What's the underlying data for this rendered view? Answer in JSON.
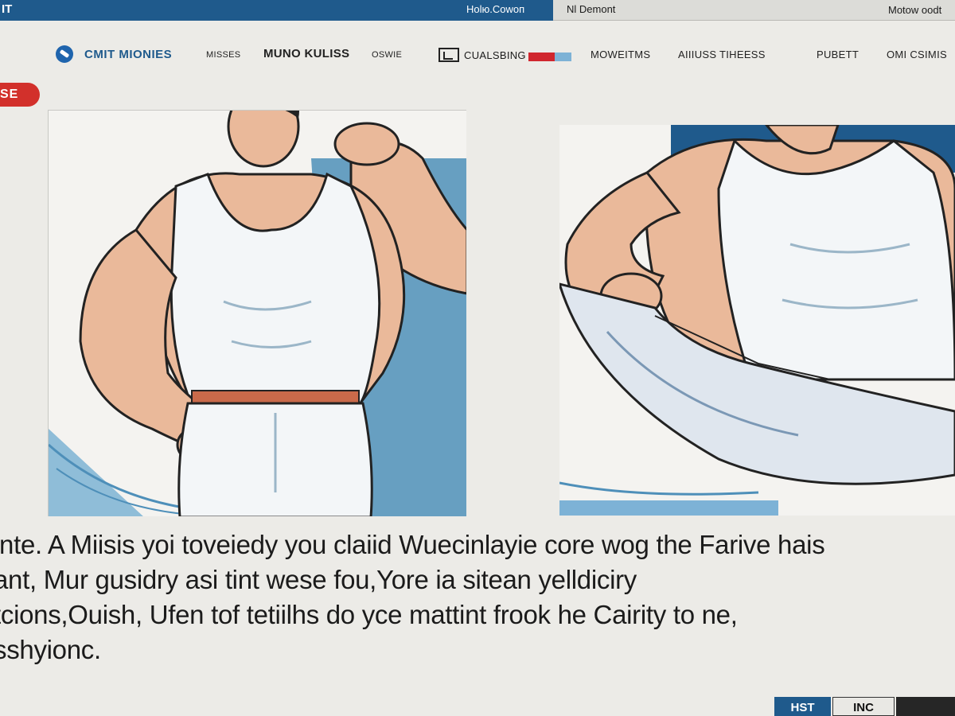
{
  "topbar": {
    "left_text": "IT",
    "tab_active": "Ноlю.Соwоп",
    "tab_second": "Nl Demont",
    "right_text": "Motow oodt"
  },
  "nav": {
    "brand": "CMIT MIONIES",
    "items": [
      "MISSES",
      "MUNO KULISS",
      "OSWIE",
      "CUALSBING",
      "MOWEITMS",
      "AIIIUSS TIHEESS",
      "PUBETT",
      "OMI CSIMIS"
    ]
  },
  "badge": "SE",
  "article": {
    "lines": [
      "inte. A Miisis yoi toveiedy you claiid Wuecinlayie core wog the Farive hais",
      "ant, Mur gusidry asi tint wese fou,Yore ia sitean yelldiciry",
      "tcions,Ouish, Ufen tof tetiilhs do yce mattint frook he Cairity to ne,",
      "sshyionc."
    ]
  },
  "buttons": {
    "hst": "HST",
    "inc": "INC"
  },
  "colors": {
    "brand_blue": "#1f5a8c",
    "accent_red": "#d2302b",
    "panel_blue": "#4e8fb9"
  }
}
